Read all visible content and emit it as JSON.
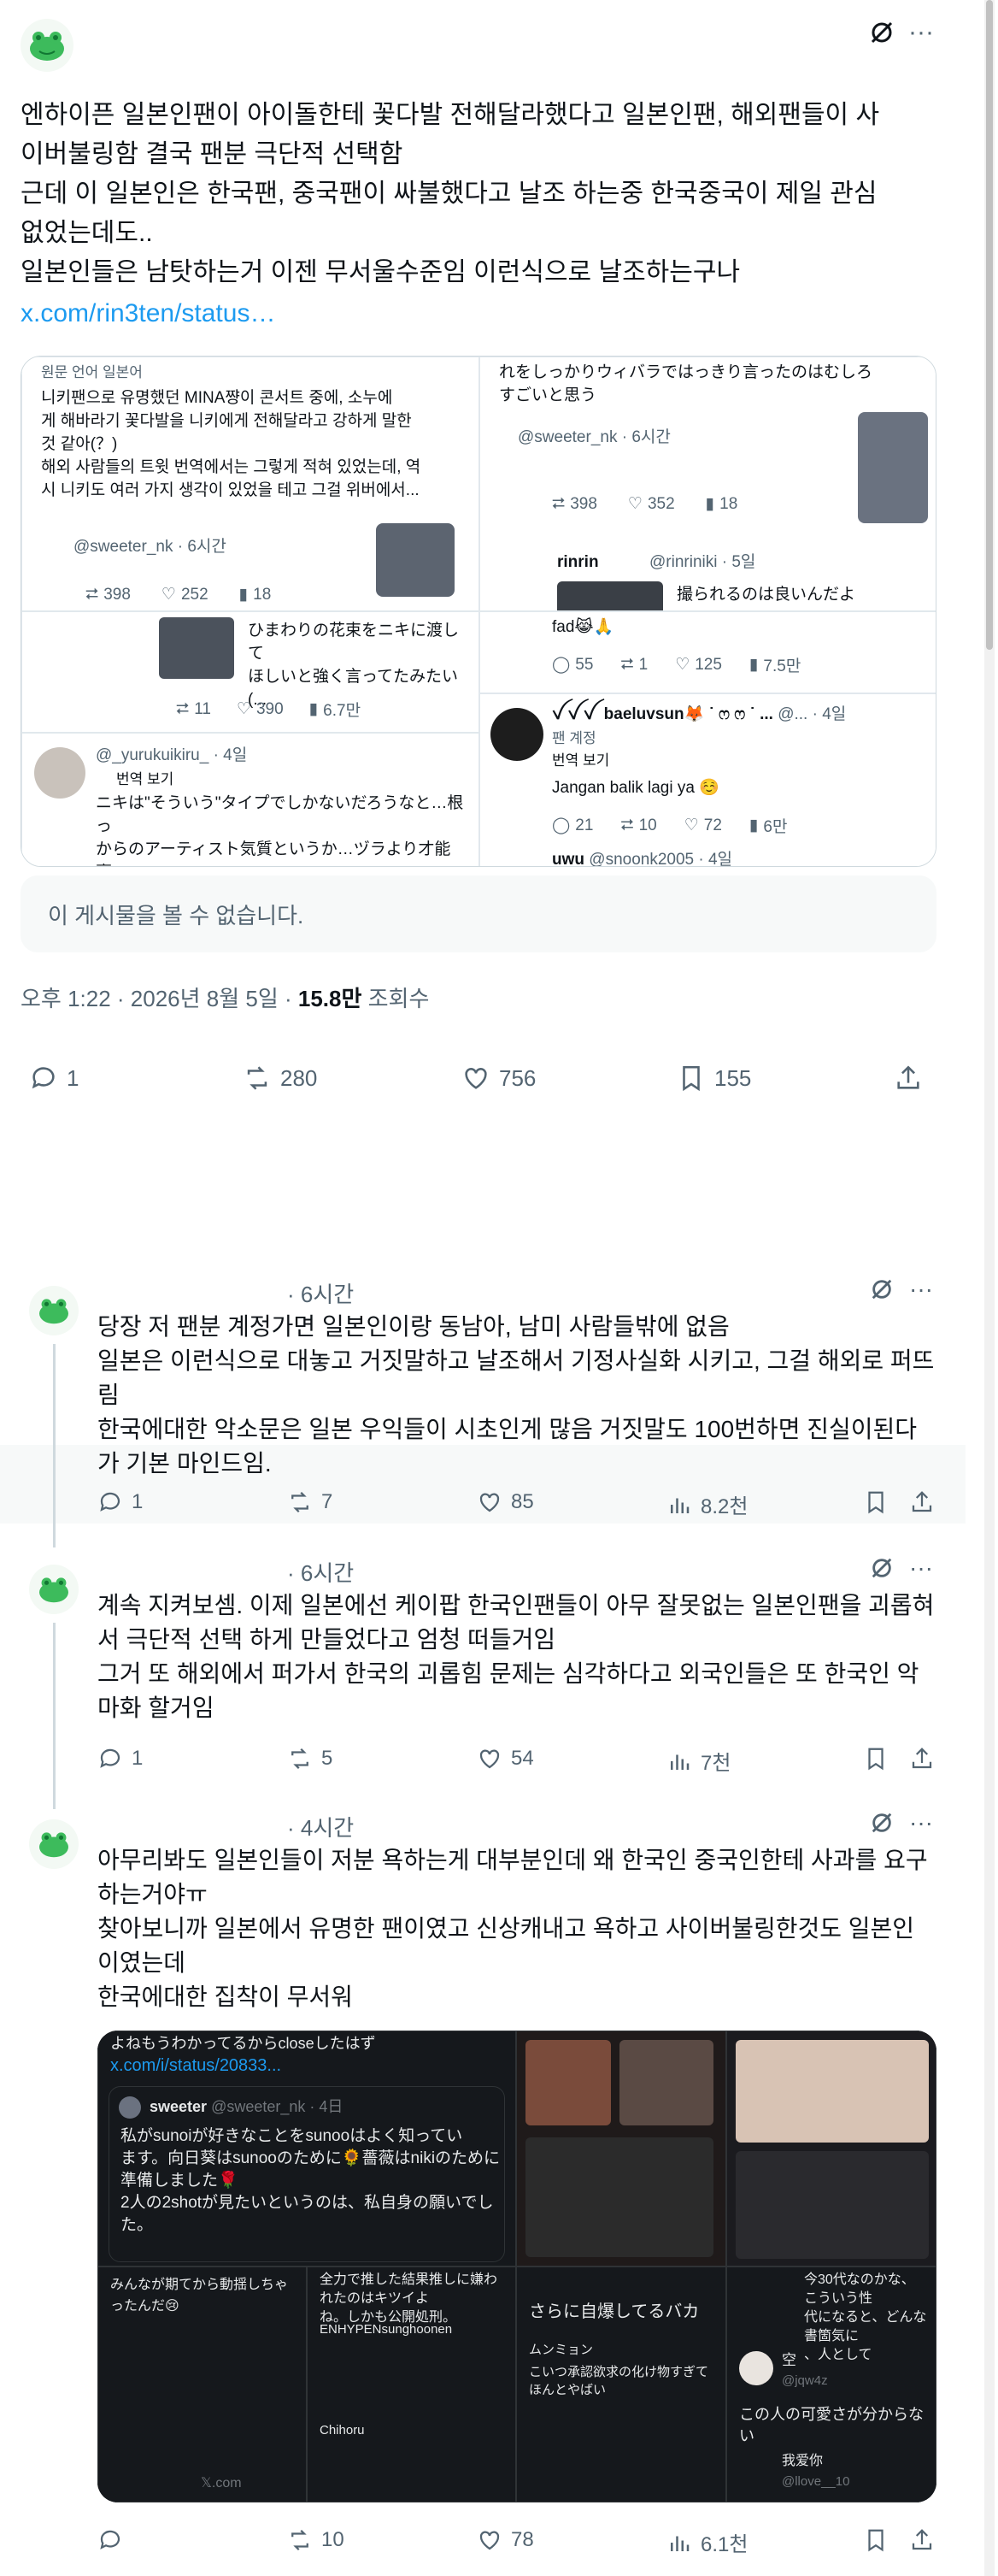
{
  "colors": {
    "accent": "#1d9bf0",
    "text": "#0f1419",
    "muted": "#536471",
    "avatar_green": "#3dbb5c"
  },
  "main": {
    "text_lines": [
      "엔하이픈 일본인팬이 아이돌한테 꽃다발 전해달라했다고 일본인팬, 해외팬들이 사",
      "이버불링함 결국 팬분 극단적 선택함",
      "근데 이 일본인은 한국팬, 중국팬이 싸불했다고 날조 하는중 한국중국이 제일 관심",
      "없었는데도..",
      "일본인들은 남탓하는거 이젠 무서울수준임 이런식으로 날조하는구나"
    ],
    "link": "x.com/rin3ten/status…",
    "unavailable": "이 게시물을 볼 수 없습니다.",
    "time": "오후 1:22 · 2026년 8월 5일 · ",
    "views_num": "15.8만",
    "views_label": " 조회수",
    "stats": {
      "replies": "1",
      "reposts": "280",
      "likes": "756",
      "bookmarks": "155"
    }
  },
  "media": {
    "tl_top": "원문 언어 일본어",
    "tl_text": "니키팬으로 유명했던 MINA쨩이 콘서트 중에, 소누에\n게 해바라기 꽃다발을 니키에게 전해달라고 강하게 말한\n것 같아(？)\n해외 사람들의 트윗 번역에서는 그렇게 적혀 있었는데, 역\n시 니키도 여러 가지 생각이 있었을 테고 그걸 위버에서...",
    "tl_user": "@sweeter_nk · 6시간",
    "tl_stats": {
      "r": "398",
      "l": "252",
      "v": "18"
    },
    "ml_text": "ひまわりの花束をニキに渡して\nほしいと強く言ってたみたい(...",
    "ml_stats": {
      "r": "11",
      "l": "390",
      "v": "6.7만"
    },
    "bl_user": "@_yurukuikiru_ · 4일",
    "bl_translate": "번역 보기",
    "bl_text": "ニキは\"そういう\"タイプでしかないだろうなと…根っ\nからのアーティスト気質というか…ヅラより才能褒\nめられたいタイプが一番不快に思うのがなんなのか",
    "tr_text": "れをしっかりウィバラではっきり言ったのはむしろ\nすごいと思う",
    "tr_user": "@sweeter_nk · 6시간",
    "tr_stats": {
      "r": "398",
      "l": "352",
      "v": "18"
    },
    "tr_q_name": "rinrin",
    "tr_q_handle": "@rinriniki · 5일",
    "tr_q_text": "撮られるのは良いんだよ",
    "mr_tail": "fad😹🙏",
    "mr_stats": {
      "c": "55",
      "r": "1",
      "l": "125",
      "v": "7.5만"
    },
    "br_name": "ꪜ ꪜ ꪜ  baeluvsun🦊 ˙ ෆ ෆ ˙ ...",
    "br_handle": "@... · 4일",
    "br_badge": "팬 계정",
    "br_translate": "번역 보기",
    "br_text": "Jangan balik lagi ya ☺️",
    "br_stats": {
      "c": "21",
      "r": "10",
      "l": "72",
      "v": "6만"
    },
    "bb_name": "uwu",
    "bb_handle": "@snoonk2005 · 4일"
  },
  "replies": [
    {
      "time": "· 6시간",
      "lines": [
        "당장 저 팬분 계정가면 일본인이랑 동남아, 남미 사람들밖에 없음",
        "일본은 이런식으로 대놓고 거짓말하고 날조해서 기정사실화 시키고, 그걸 해외로 퍼뜨",
        "림",
        "한국에대한 악소문은 일본 우익들이 시초인게 많음 거짓말도 100번하면 진실이된다",
        "가 기본 마인드임."
      ],
      "stats": {
        "replies": "1",
        "reposts": "7",
        "likes": "85",
        "views": "8.2천"
      }
    },
    {
      "time": "· 6시간",
      "lines": [
        "계속 지켜보셈. 이제 일본에선 케이팝 한국인팬들이 아무 잘못없는 일본인팬을 괴롭혀",
        "서 극단적 선택 하게 만들었다고 엄청 떠들거임",
        "그거 또 해외에서 퍼가서 한국의 괴롭힘 문제는 심각하다고 외국인들은 또 한국인 악",
        "마화 할거임"
      ],
      "stats": {
        "replies": "1",
        "reposts": "5",
        "likes": "54",
        "views": "7천"
      }
    },
    {
      "time": "· 4시간",
      "lines": [
        "아무리봐도 일본인들이 저분 욕하는게 대부분인데 왜 한국인 중국인한테 사과를 요구",
        "하는거야ㅠ",
        "찾아보니까 일본에서 유명한 팬이였고 신상캐내고 욕하고 사이버불링한것도 일본인",
        "이였는데",
        "한국에대한 집착이 무서워"
      ],
      "stats": {
        "replies": "",
        "reposts": "10",
        "likes": "78",
        "views": "6.1천"
      }
    }
  ],
  "reply_media": {
    "c1_top": "よねもうわかってるからcloseしたはず",
    "c1_link": "x.com/i/status/20833...",
    "c1_name": "sweeter",
    "c1_handle": "@sweeter_nk · 4日",
    "c1_text": "私がsunoiが好きなことをsunooはよく知ってい\nます。向日葵はsunooのために🌻薔薇はnikiのために\n準備しました🌹\n2人の2shotが見たいというのは、私自身の願いでし\nた。",
    "c2_a": "みんなが期てから動揺しちゃったんだ😢",
    "c2_b": "全力で推した結果推しに嫌われたのはキツイよ\nね。しかも公開処刑。",
    "c2_name1": "ENHYPENsunghoonen",
    "c2_name2": "Chihoru",
    "c2_x": "𝕏.com",
    "c3_a": "さらに自爆してるバカ",
    "c3_b": "ムンミョン",
    "c3_c": "こいつ承認欲求の化け物すぎてほんとやばい",
    "c4_a": "今30代なのかな、こういう性\n代になると、どんな書箇気に\n、人として",
    "c4_name": "空",
    "c4_handle": "@jqw4z",
    "c4_text": "この人の可愛さが分からない",
    "c4_b": "我爱你",
    "c4_c": "@llove__10"
  }
}
